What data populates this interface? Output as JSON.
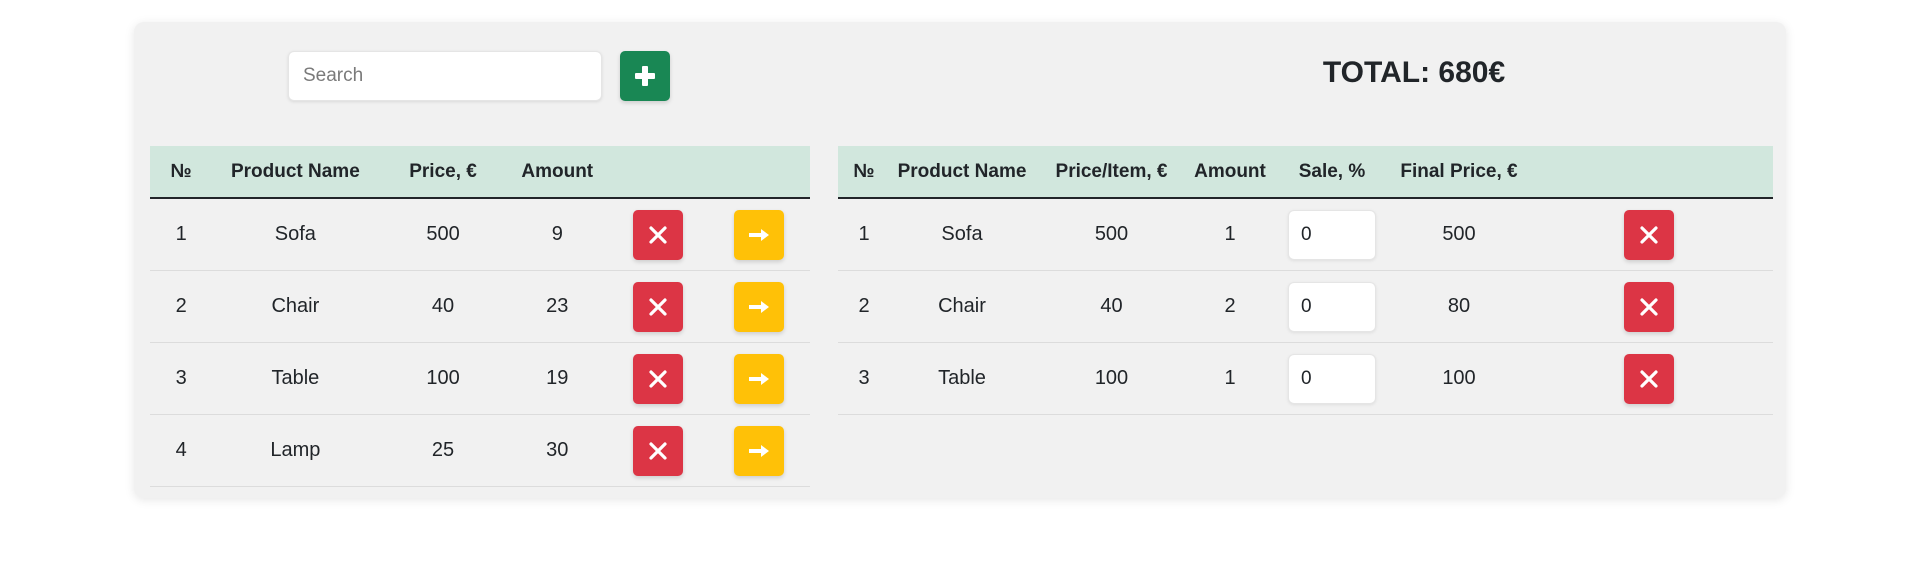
{
  "search": {
    "placeholder": "Search",
    "value": ""
  },
  "add_button": {
    "icon": "plus-icon"
  },
  "total": {
    "text": "TOTAL: 680€"
  },
  "colors": {
    "panel_bg": "#f1f1f1",
    "header_bg": "#d1e7dd",
    "add_green": "#198754",
    "delete_red": "#dc3545",
    "move_yellow": "#ffc107"
  },
  "products_table": {
    "headers": [
      "№",
      "Product Name",
      "Price, €",
      "Amount"
    ],
    "rows": [
      {
        "no": "1",
        "name": "Sofa",
        "price": "500",
        "amount": "9"
      },
      {
        "no": "2",
        "name": "Chair",
        "price": "40",
        "amount": "23"
      },
      {
        "no": "3",
        "name": "Table",
        "price": "100",
        "amount": "19"
      },
      {
        "no": "4",
        "name": "Lamp",
        "price": "25",
        "amount": "30"
      }
    ]
  },
  "cart_table": {
    "headers": [
      "№",
      "Product Name",
      "Price/Item, €",
      "Amount",
      "Sale, %",
      "Final Price, €"
    ],
    "rows": [
      {
        "no": "1",
        "name": "Sofa",
        "price": "500",
        "amount": "1",
        "sale": "0",
        "final": "500"
      },
      {
        "no": "2",
        "name": "Chair",
        "price": "40",
        "amount": "2",
        "sale": "0",
        "final": "80"
      },
      {
        "no": "3",
        "name": "Table",
        "price": "100",
        "amount": "1",
        "sale": "0",
        "final": "100"
      }
    ]
  },
  "icons": {
    "delete": "close-icon",
    "move": "arrow-right-icon",
    "add": "plus-icon"
  }
}
